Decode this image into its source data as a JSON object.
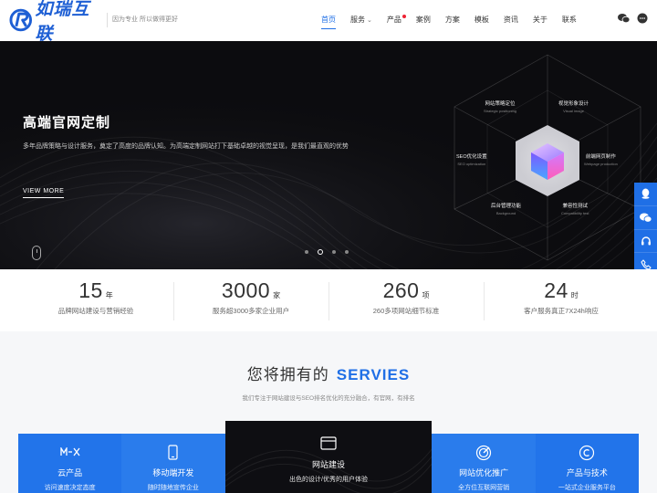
{
  "header": {
    "logo_text": "如瑞互联",
    "slogan": "因为专业 所以做得更好",
    "nav": [
      {
        "label": "首页",
        "active": true
      },
      {
        "label": "服务",
        "has_caret": true
      },
      {
        "label": "产品",
        "has_dot": true
      },
      {
        "label": "案例"
      },
      {
        "label": "方案"
      },
      {
        "label": "模板"
      },
      {
        "label": "资讯"
      },
      {
        "label": "关于"
      },
      {
        "label": "联系"
      }
    ],
    "right_icons": [
      "wechat-icon",
      "chat-icon"
    ]
  },
  "hero": {
    "title": "高端官网定制",
    "subtitle": "多年品牌策略与设计服务，奠定了高度的品牌认知。为高端定制网站打下基础卓越的视觉呈现，是我们最直观的优势",
    "cta": "VIEW MORE",
    "slides_total": 4,
    "slide_active": 2,
    "hex_labels": [
      {
        "cn": "网站策略定位",
        "en": "Strategic positioning"
      },
      {
        "cn": "视觉形象设计",
        "en": "Visual image"
      },
      {
        "cn": "SEO优化设置",
        "en": "SEO optimization"
      },
      {
        "cn": "前端网页制作",
        "en": "Webpage production"
      },
      {
        "cn": "后台管理功能",
        "en": "Background"
      },
      {
        "cn": "兼容性测试",
        "en": "Compatibility test"
      }
    ]
  },
  "sidebar": {
    "buttons": [
      "qq-icon",
      "wechat-icon",
      "headset-icon",
      "phone-icon",
      "edit-icon",
      "arrow-up-icon"
    ]
  },
  "stats": [
    {
      "value": "15",
      "unit": "年",
      "desc": "品牌网站建设与营销经验"
    },
    {
      "value": "3000",
      "unit": "家",
      "desc": "服务超3000多家企业用户"
    },
    {
      "value": "260",
      "unit": "项",
      "desc": "260多项网站细节标准"
    },
    {
      "value": "24",
      "unit": "时",
      "desc": "客户服务真正7X24h响应"
    }
  ],
  "services": {
    "title": "您将拥有的",
    "title_accent": "SERVIES",
    "subtitle": "我们专注于网站建设与SEO排名优化的充分融合，有官网，有排名",
    "cards": [
      {
        "icon": "cloud-product-icon",
        "title": "云产品",
        "desc": "访问速度决定态度"
      },
      {
        "icon": "mobile-icon",
        "title": "移动端开发",
        "desc": "随时随地宣传企业"
      },
      {
        "icon": "browser-icon",
        "title": "网站建设",
        "desc": "出色的设计/优秀的用户体验",
        "featured": true
      },
      {
        "icon": "optimize-icon",
        "title": "网站优化推广",
        "desc": "全方位互联网营销"
      },
      {
        "icon": "copyright-icon",
        "title": "产品与技术",
        "desc": "一站式企业服务平台"
      }
    ]
  },
  "colors": {
    "brand_blue": "#1f6fe6",
    "hero_bg": "#0c0c0f",
    "nav_dot": "#e22233"
  }
}
